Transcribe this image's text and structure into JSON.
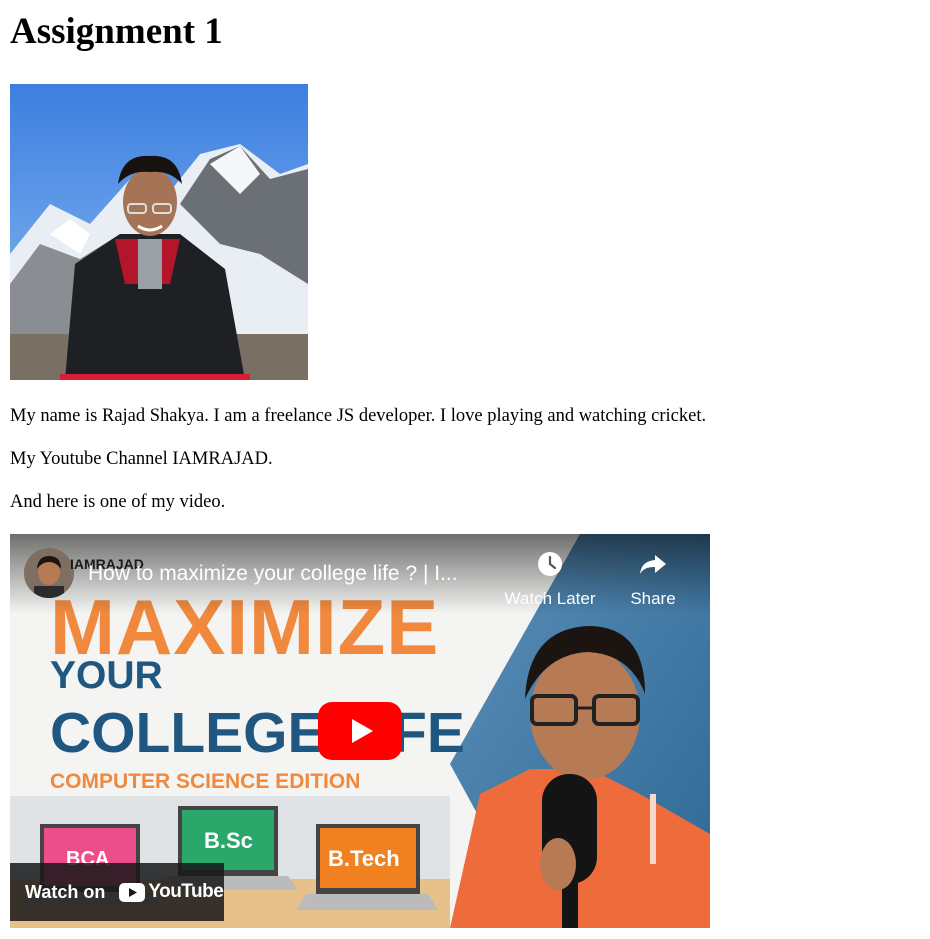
{
  "page": {
    "heading": "Assignment 1",
    "paragraphs": [
      "My name is Rajad Shakya. I am a freelance JS developer. I love playing and watching cricket.",
      "My Youtube Channel IAMRAJAD.",
      "And here is one of my video."
    ]
  },
  "video": {
    "channel_name": "IAMRAJAD",
    "title": "How to maximize your college life ? | I...",
    "watch_later_label": "Watch Later",
    "share_label": "Share",
    "watch_on_label": "Watch on",
    "youtube_wordmark": "YouTube",
    "thumbnail": {
      "line1": "MAXIMIZE",
      "line2": "YOUR",
      "line3": "COLLEGE LIFE",
      "line4": "COMPUTER SCIENCE EDITION",
      "laptop_labels": [
        "BCA",
        "B.Sc",
        "B.Tech"
      ]
    },
    "colors": {
      "play_red": "#ff0000",
      "thumb_orange": "#f0893e",
      "thumb_blue": "#1f5780"
    }
  }
}
